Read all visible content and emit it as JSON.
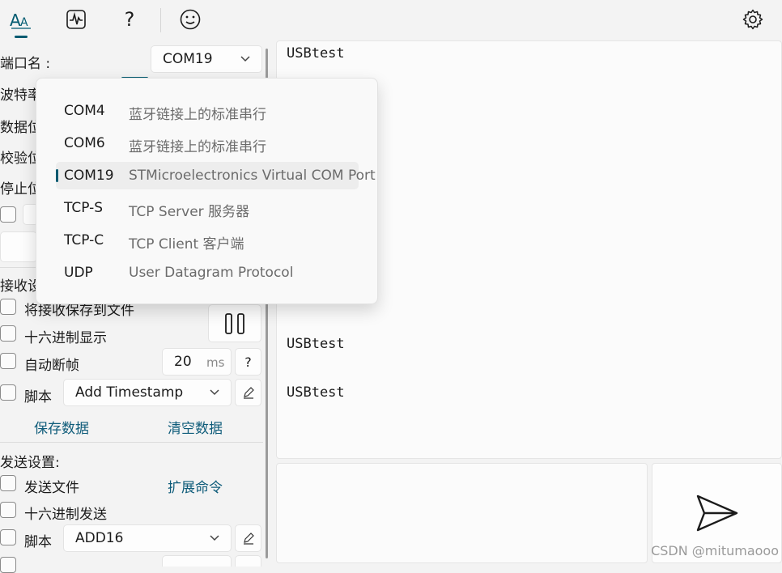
{
  "toolbar": {
    "serial_tab_icon": "font-aa-icon",
    "wave_icon": "waveform-icon",
    "help_label": "?",
    "emoji_icon": "smiley-icon",
    "settings_icon": "gear-icon"
  },
  "serial": {
    "port_label": "端口名 :",
    "port_value": "COM19",
    "baud_label": "波特率",
    "databits_label": "数据位",
    "parity_label": "校验位",
    "stopbits_label": "停止位"
  },
  "receive": {
    "section_label": "接收设",
    "save_to_file": "将接收保存到文件",
    "hex_display": "十六进制显示",
    "auto_frame": "自动断帧",
    "frame_ms_value": "20",
    "frame_ms_unit": "ms",
    "frame_help": "?",
    "script_label": "脚本",
    "script_value": "Add Timestamp",
    "save_data": "保存数据",
    "clear_data": "清空数据"
  },
  "send": {
    "section_label": "发送设置:",
    "send_file": "发送文件",
    "ext_cmd": "扩展命令",
    "hex_send": "十六进制发送",
    "script_label": "脚本",
    "script_value": "ADD16"
  },
  "recv_lines": [
    "USBtest",
    "USBtest",
    "USBtest"
  ],
  "port_options": [
    {
      "port": "COM4",
      "desc": "蓝牙链接上的标准串行",
      "selected": false
    },
    {
      "port": "COM6",
      "desc": "蓝牙链接上的标准串行",
      "selected": false
    },
    {
      "port": "COM19",
      "desc": "STMicroelectronics Virtual COM Port",
      "selected": true
    },
    {
      "port": "TCP-S",
      "desc": "TCP Server 服务器",
      "selected": false
    },
    {
      "port": "TCP-C",
      "desc": "TCP Client 客户端",
      "selected": false
    },
    {
      "port": "UDP",
      "desc": "User Datagram Protocol",
      "selected": false
    }
  ],
  "watermark": "CSDN @mitumaooo",
  "colors": {
    "accent": "#005a70",
    "link": "#0f5c7a"
  }
}
